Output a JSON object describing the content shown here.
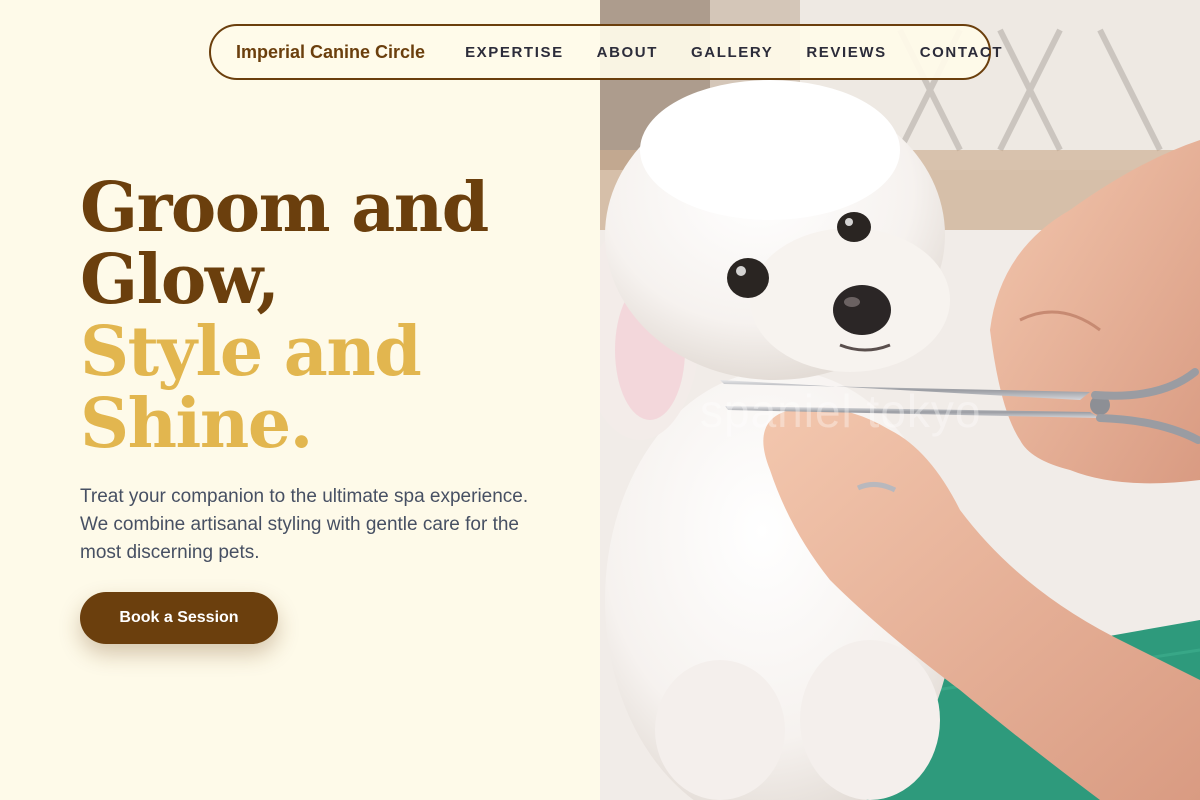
{
  "nav": {
    "brand": "Imperial Canine Circle",
    "links": [
      "EXPERTISE",
      "ABOUT",
      "GALLERY",
      "REVIEWS",
      "CONTACT"
    ]
  },
  "hero": {
    "title_line1": "Groom and",
    "title_line2": "Glow,",
    "title_line3": "Style and",
    "title_line4": "Shine.",
    "description": "Treat your companion to the ultimate spa experience. We combine artisanal styling with gentle care for the most discerning pets.",
    "cta_label": "Book a Session"
  },
  "photo": {
    "subject": "white poodle being groomed with scissors",
    "watermark": "spaniel tokyo"
  },
  "colors": {
    "brown": "#6b3f0d",
    "gold": "#e2b64f",
    "cream": "#fefae9",
    "text_gray": "#475063"
  }
}
